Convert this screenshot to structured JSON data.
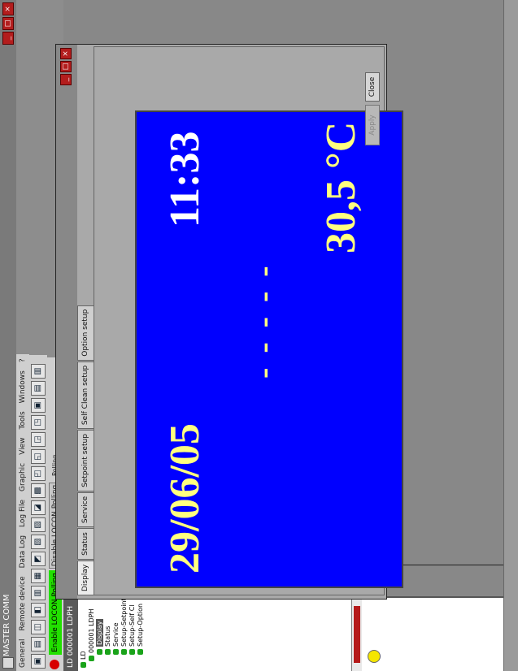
{
  "app": {
    "title": "MASTER COMM"
  },
  "menu": {
    "items": [
      "General",
      "Remote device",
      "Data Log",
      "Log File",
      "Graphic",
      "View",
      "Tools",
      "Windows",
      "?"
    ]
  },
  "status": {
    "enable_label": "Enable LOCON Polling",
    "disable_label": "Disable LOCON Polling",
    "polling_label": "Polling"
  },
  "tree": {
    "header": "LD 000001 LDPH",
    "items": [
      {
        "label": "LD"
      },
      {
        "label": "000001 LDPH"
      },
      {
        "label": "Display"
      },
      {
        "label": "Status"
      },
      {
        "label": "Service"
      },
      {
        "label": "Setup-Setpoint"
      },
      {
        "label": "Setup-Self Cl"
      },
      {
        "label": "Setup-Option"
      }
    ]
  },
  "dialog": {
    "tabs": [
      "Display",
      "Status",
      "Service",
      "Setpoint setup",
      "Self Clean setup",
      "Option setup"
    ],
    "active_tab": "Display",
    "display": {
      "date": "29/06/05",
      "time": "11:33",
      "value": "- - - - -",
      "temperature": "30,5 °C"
    },
    "apply_label": "Apply",
    "close_label": "Close"
  },
  "colors": {
    "display_bg": "#0000ff",
    "display_text": "#ffff80",
    "time_text": "#ffffff",
    "enable_green": "#22e000"
  },
  "icons": [
    "app-icon",
    "minimize-icon",
    "restore-icon",
    "close-icon",
    "status-led-red",
    "status-led-yellow",
    "tree-leaf-icon"
  ]
}
